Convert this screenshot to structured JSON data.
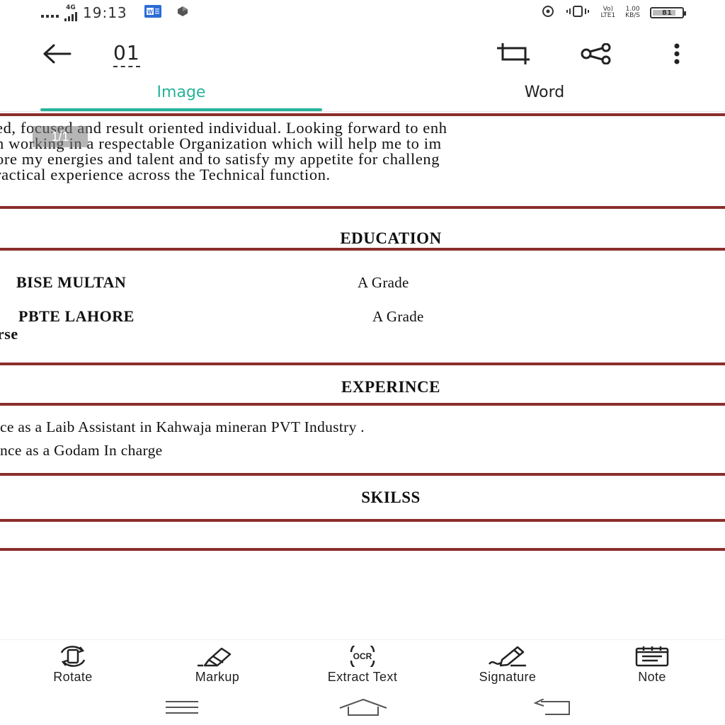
{
  "status_bar": {
    "network": "4G",
    "time": "19:13",
    "volte": "Vo)",
    "lte": "LTE1",
    "speed_value": "1.00",
    "speed_unit": "KB/S",
    "battery": "81"
  },
  "toolbar": {
    "title": "01"
  },
  "tabs": [
    {
      "label": "Image"
    },
    {
      "label": "Word"
    }
  ],
  "document": {
    "page_indicator": "1/1",
    "intro_lines": [
      "ed, focused and result oriented individual. Looking forward to enh",
      "n working in a respectable Organization which will help me to im",
      "ore my energies and talent and to satisfy my appetite for challeng",
      "ractical experience across the Technical function."
    ],
    "education": {
      "heading": "EDUCATION",
      "rows": [
        {
          "institution": "BISE MULTAN",
          "grade": "A Grade"
        },
        {
          "institution": "PBTE LAHORE",
          "grade": "A Grade"
        }
      ],
      "trailing_text": "rse"
    },
    "experience": {
      "heading": "EXPERINCE",
      "items": [
        "ce as a Laib Assistant in Kahwaja mineran PVT Industry .",
        "nce as a Godam In charge"
      ]
    },
    "skills": {
      "heading": "SKILSS"
    }
  },
  "actions": [
    {
      "label": "Rotate",
      "icon": "rotate-icon"
    },
    {
      "label": "Markup",
      "icon": "markup-icon"
    },
    {
      "label": "Extract Text",
      "icon": "ocr-icon"
    },
    {
      "label": "Signature",
      "icon": "signature-icon"
    },
    {
      "label": "Note",
      "icon": "note-icon"
    }
  ],
  "colors": {
    "accent": "#26b39a",
    "rule": "#8b2e2c"
  }
}
